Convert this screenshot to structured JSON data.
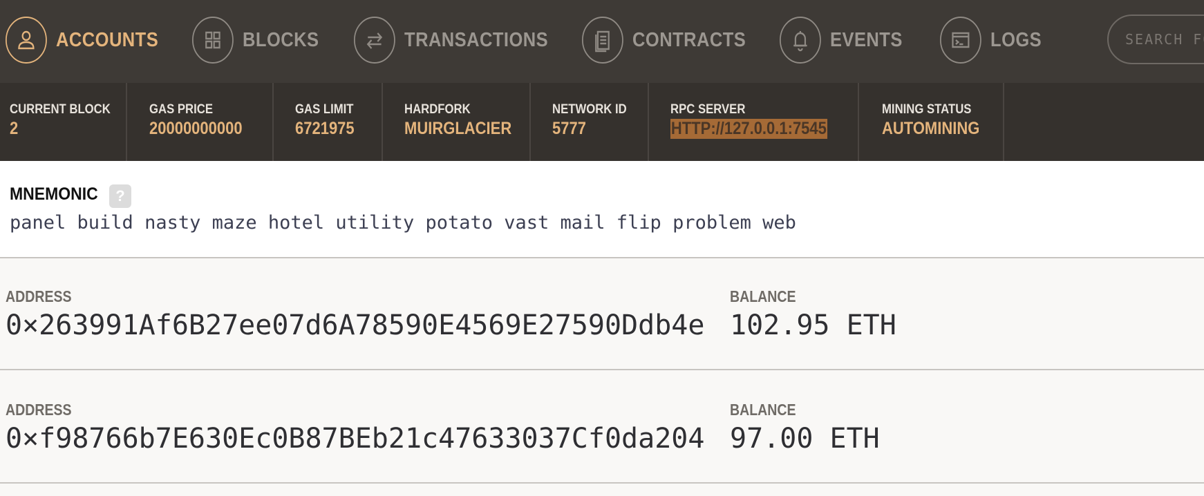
{
  "nav": {
    "items": [
      {
        "label": "ACCOUNTS",
        "icon": "user-icon",
        "active": true
      },
      {
        "label": "BLOCKS",
        "icon": "blocks-icon",
        "active": false
      },
      {
        "label": "TRANSACTIONS",
        "icon": "transfer-arrows-icon",
        "active": false
      },
      {
        "label": "CONTRACTS",
        "icon": "document-icon",
        "active": false
      },
      {
        "label": "EVENTS",
        "icon": "bell-icon",
        "active": false
      },
      {
        "label": "LOGS",
        "icon": "terminal-icon",
        "active": false
      }
    ],
    "search_placeholder": "SEARCH FO"
  },
  "stats": [
    {
      "label": "CURRENT BLOCK",
      "value": "2"
    },
    {
      "label": "GAS PRICE",
      "value": "20000000000"
    },
    {
      "label": "GAS LIMIT",
      "value": "6721975"
    },
    {
      "label": "HARDFORK",
      "value": "MUIRGLACIER"
    },
    {
      "label": "NETWORK ID",
      "value": "5777"
    },
    {
      "label": "RPC SERVER",
      "value": "HTTP://127.0.0.1:7545"
    },
    {
      "label": "MINING STATUS",
      "value": "AUTOMINING"
    }
  ],
  "mnemonic": {
    "title": "MNEMONIC",
    "help": "?",
    "words": "panel build nasty maze hotel utility potato vast mail flip problem web"
  },
  "accounts": [
    {
      "address_label": "ADDRESS",
      "address": "0×263991Af6B27ee07d6A78590E4569E27590Ddb4e",
      "balance_label": "BALANCE",
      "balance": "102.95 ETH"
    },
    {
      "address_label": "ADDRESS",
      "address": "0×f98766b7E630Ec0B87BEb21c47633037Cf0da204",
      "balance_label": "BALANCE",
      "balance": "97.00 ETH"
    }
  ],
  "colors": {
    "accent": "#e4b47c",
    "nav_bg": "#3e3a36",
    "stats_bg": "#35312d",
    "highlight": "#a56a36"
  }
}
